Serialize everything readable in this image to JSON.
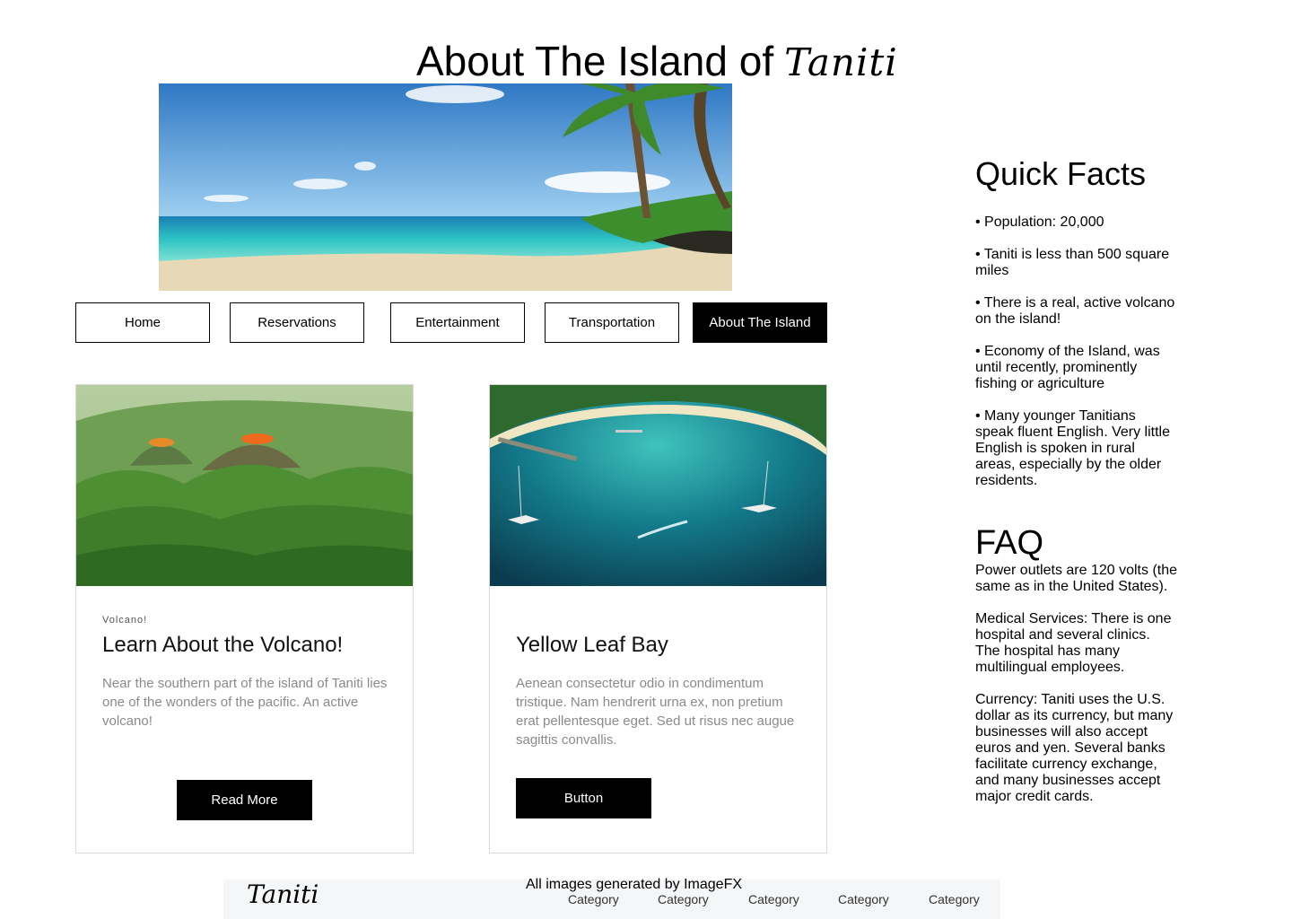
{
  "header": {
    "title": "About The Island of",
    "script_word": "Taniti"
  },
  "nav": {
    "items": [
      "Home",
      "Reservations",
      "Entertainment",
      "Transportation",
      "About The Island"
    ],
    "active": "About The Island"
  },
  "cards": [
    {
      "tag": "Volcano!",
      "title": "Learn About the Volcano!",
      "text": "Near the southern part of the island of Taniti lies one of the wonders of the pacific. An active volcano!",
      "button": "Read More"
    },
    {
      "tag": "",
      "title": "Yellow Leaf Bay",
      "text": "Aenean consectetur odio in condimentum tristique. Nam hendrerit urna ex, non pretium erat pellentesque eget. Sed ut risus nec augue sagittis convallis.",
      "button": "Button"
    }
  ],
  "quick_facts": {
    "heading": "Quick Facts",
    "items": [
      "• Population: 20,000",
      "• Taniti is less than 500 square miles",
      "• There is a real, active volcano on the island!",
      "• Economy of the Island, was until recently, prominently fishing or agriculture",
      "• Many younger Tanitians speak fluent English. Very little English is spoken in rural areas, especially by the older residents."
    ]
  },
  "faq": {
    "heading": "FAQ",
    "items": [
      "Power outlets are 120 volts (the same as in the United States).",
      "Medical Services: There is one hospital and several clinics. The hospital has many multilingual employees.",
      "Currency: Taniti uses the U.S. dollar as its currency, but many businesses will also accept euros and yen. Several banks facilitate currency exchange, and many businesses accept major credit cards."
    ]
  },
  "footer": {
    "logo": "Taniti",
    "credit": "All images generated by ImageFX",
    "categories": [
      "Category",
      "Category",
      "Category",
      "Category",
      "Category"
    ]
  },
  "colors": {
    "accent": "#000000",
    "card_border": "#d9d9d9",
    "muted_text": "#8a8a8a",
    "footer_bg": "#f5f6f7"
  }
}
